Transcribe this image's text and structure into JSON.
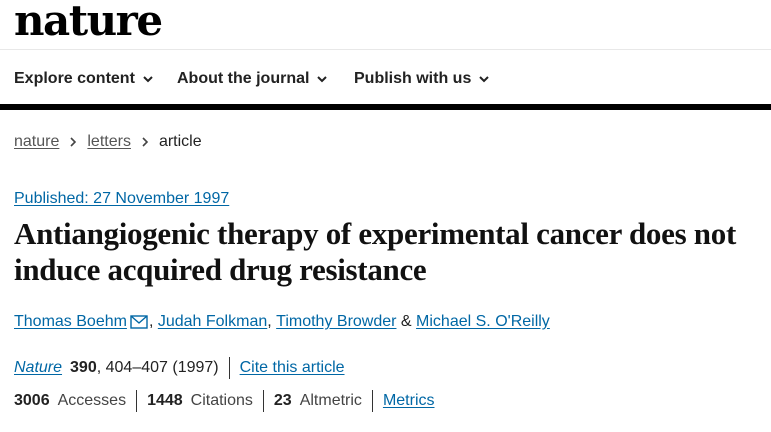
{
  "site": {
    "logo": "nature"
  },
  "nav": {
    "items": [
      {
        "label": "Explore content",
        "icon": "chevron-down-icon"
      },
      {
        "label": "About the journal",
        "icon": "chevron-down-icon"
      },
      {
        "label": "Publish with us",
        "icon": "chevron-down-icon"
      }
    ]
  },
  "breadcrumb": {
    "items": [
      "nature",
      "letters"
    ],
    "current": "article",
    "separator_icon": "chevron-right-icon"
  },
  "article": {
    "published": "Published: 27 November 1997",
    "title": "Antiangiogenic therapy of experimental cancer does not induce acquired drug resistance",
    "authors": [
      "Thomas Boehm",
      "Judah Folkman",
      "Timothy Browder",
      "Michael S. O'Reilly"
    ],
    "author_separator": ",",
    "author_ampersand": "&",
    "mail_icon": "envelope-icon",
    "citation": {
      "journal": "Nature",
      "volume": "390",
      "pages": ", 404–407 (1997)",
      "cite_label": "Cite this article"
    },
    "metrics": {
      "accesses_count": "3006",
      "accesses_label": "Accesses",
      "citations_count": "1448",
      "citations_label": "Citations",
      "altmetric_count": "23",
      "altmetric_label": "Altmetric",
      "metrics_link": "Metrics"
    }
  },
  "colors": {
    "link": "#0067a5",
    "text": "#222222",
    "rule": "#000000"
  }
}
